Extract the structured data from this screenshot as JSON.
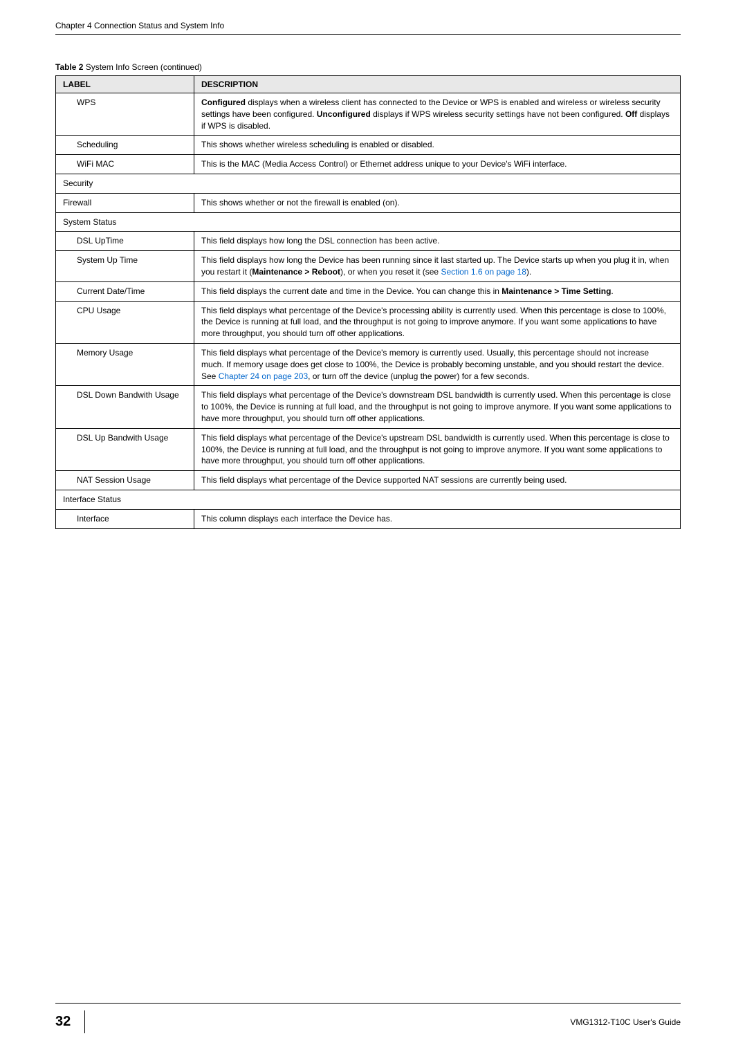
{
  "header": {
    "chapter_title": "Chapter 4 Connection Status and System Info"
  },
  "table": {
    "caption_bold": "Table 2",
    "caption_text": "   System Info Screen (continued)",
    "header_label": "LABEL",
    "header_description": "DESCRIPTION",
    "rows": [
      {
        "label": "WPS",
        "indent": true,
        "desc_parts": [
          {
            "bold": true,
            "text": "Configured"
          },
          {
            "bold": false,
            "text": " displays when a wireless client has connected to the Device or WPS is enabled and wireless or wireless security settings have been configured. "
          },
          {
            "bold": true,
            "text": "Unconfigured"
          },
          {
            "bold": false,
            "text": " displays if WPS wireless security settings have not been configured. "
          },
          {
            "bold": true,
            "text": "Off"
          },
          {
            "bold": false,
            "text": " displays if WPS is disabled."
          }
        ]
      },
      {
        "label": "Scheduling",
        "indent": true,
        "desc": "This shows whether wireless scheduling is enabled or disabled."
      },
      {
        "label": "WiFi MAC",
        "indent": true,
        "desc": "This is the MAC (Media Access Control) or Ethernet address unique to your Device's WiFi interface."
      },
      {
        "label": "Security",
        "section": true
      },
      {
        "label": "Firewall",
        "indent": false,
        "desc": "This shows whether or not the firewall is enabled (on)."
      },
      {
        "label": "System Status",
        "section": true
      },
      {
        "label": "DSL UpTime",
        "indent": true,
        "desc": "This field displays how long the DSL connection has been active."
      },
      {
        "label": "System Up Time",
        "indent": true,
        "desc_parts": [
          {
            "bold": false,
            "text": "This field displays how long the Device has been running since it last started up. The Device starts up when you plug it in, when you restart it ("
          },
          {
            "bold": true,
            "text": "Maintenance > Reboot"
          },
          {
            "bold": false,
            "text": "), or when you reset it (see "
          },
          {
            "link": true,
            "text": "Section 1.6 on page 18"
          },
          {
            "bold": false,
            "text": ")."
          }
        ]
      },
      {
        "label": "Current Date/Time",
        "indent": true,
        "desc_parts": [
          {
            "bold": false,
            "text": "This field displays the current date and time in the Device. You can change this in "
          },
          {
            "bold": true,
            "text": "Maintenance > Time Setting"
          },
          {
            "bold": false,
            "text": "."
          }
        ]
      },
      {
        "label": "CPU Usage",
        "indent": true,
        "desc": "This field displays what percentage of the Device's processing ability is currently used. When this percentage is close to 100%, the Device is running at full load, and the throughput is not going to improve anymore. If you want some applications to have more throughput, you should turn off other applications."
      },
      {
        "label": "Memory Usage",
        "indent": true,
        "desc_parts": [
          {
            "bold": false,
            "text": "This field displays what percentage of the Device's memory is currently used. Usually, this percentage should not increase much. If memory usage does get close to 100%, the Device is probably becoming unstable, and you should restart the device. See "
          },
          {
            "link": true,
            "text": "Chapter 24 on page 203"
          },
          {
            "bold": false,
            "text": ", or turn off the device (unplug the power) for a few seconds."
          }
        ]
      },
      {
        "label": "DSL Down Bandwith Usage",
        "indent": true,
        "desc": "This field displays what percentage of the Device's downstream DSL bandwidth is currently used. When this percentage is close to 100%, the Device is running at full load, and the throughput is not going to improve anymore. If you want some applications to have more throughput, you should turn off other applications."
      },
      {
        "label": "DSL Up Bandwith Usage",
        "indent": true,
        "desc": "This field displays what percentage of the Device's upstream DSL bandwidth is currently used. When this percentage is close to 100%, the Device is running at full load, and the throughput is not going to improve anymore. If you want some applications to have more throughput, you should turn off other applications."
      },
      {
        "label": "NAT Session Usage",
        "indent": true,
        "desc": "This field displays what percentage of the Device supported NAT sessions are currently being used."
      },
      {
        "label": "Interface Status",
        "section": true
      },
      {
        "label": "Interface",
        "indent": true,
        "desc": "This column displays each interface the Device has."
      }
    ]
  },
  "footer": {
    "page_number": "32",
    "guide_title": "VMG1312-T10C User's Guide"
  }
}
